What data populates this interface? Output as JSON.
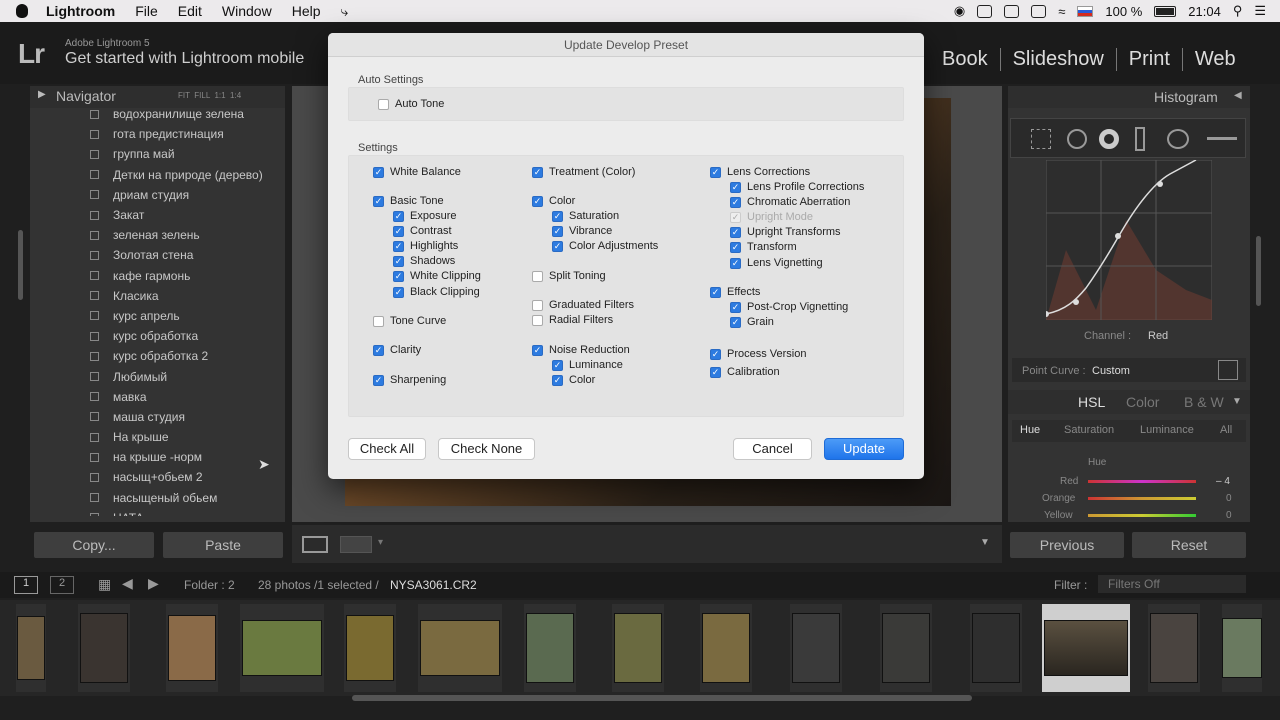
{
  "menubar": {
    "app": "Lightroom",
    "items": [
      "File",
      "Edit",
      "Window",
      "Help"
    ],
    "battery": "100 %",
    "time": "21:04"
  },
  "header": {
    "logo": "Lr",
    "version": "Adobe Lightroom 5",
    "mobile": "Get started with Lightroom mobile",
    "modules": [
      "Book",
      "Slideshow",
      "Print",
      "Web"
    ]
  },
  "left": {
    "navigator": "Navigator",
    "nav_opts": "FIT  FILL  1:1  1:4",
    "presets": [
      "водохранилище зелена",
      "гота предистинация",
      "группа май",
      "Детки на природе (дерево)",
      "дриам студия",
      "Закат",
      "зеленая зелень",
      "Золотая стена",
      "кафе гармонь",
      "Класика",
      "курс апрель",
      "курс обработка",
      "курс обработка 2",
      "Любимый",
      "мавка",
      "маша студия",
      "На крыше",
      "на крыше -норм",
      "насыщ+обьем 2",
      "насыщеный обьем",
      "НАТА..."
    ],
    "copy": "Copy...",
    "paste": "Paste"
  },
  "right": {
    "histogram": "Histogram",
    "channel_label": "Channel :",
    "channel_value": "Red",
    "point_curve_label": "Point Curve :",
    "point_curve_value": "Custom",
    "hsl_tabs": [
      "HSL",
      "Color",
      "B & W"
    ],
    "hsl_sub": [
      "Hue",
      "Saturation",
      "Luminance",
      "All"
    ],
    "hue_title": "Hue",
    "hue_rows": [
      {
        "name": "Red",
        "value": "– 4"
      },
      {
        "name": "Orange",
        "value": "0"
      },
      {
        "name": "Yellow",
        "value": "0"
      }
    ],
    "previous": "Previous",
    "reset": "Reset"
  },
  "filmstrip": {
    "pages": [
      "1",
      "2"
    ],
    "folder": "Folder : 2",
    "count": "28 photos /1 selected /",
    "file": "NYSA3061.CR2",
    "filter_label": "Filter :",
    "filter_value": "Filters Off"
  },
  "dialog": {
    "title": "Update Develop Preset",
    "auto_section": "Auto Settings",
    "auto_tone": "Auto Tone",
    "settings_section": "Settings",
    "col1": [
      {
        "label": "White Balance",
        "on": true,
        "indent": 0
      },
      {
        "label": "Basic Tone",
        "on": true,
        "indent": 0
      },
      {
        "label": "Exposure",
        "on": true,
        "indent": 1
      },
      {
        "label": "Contrast",
        "on": true,
        "indent": 1
      },
      {
        "label": "Highlights",
        "on": true,
        "indent": 1
      },
      {
        "label": "Shadows",
        "on": true,
        "indent": 1
      },
      {
        "label": "White Clipping",
        "on": true,
        "indent": 1
      },
      {
        "label": "Black Clipping",
        "on": true,
        "indent": 1
      },
      {
        "label": "Tone Curve",
        "on": false,
        "indent": 0
      },
      {
        "label": "Clarity",
        "on": true,
        "indent": 0
      },
      {
        "label": "Sharpening",
        "on": true,
        "indent": 0
      }
    ],
    "col2": [
      {
        "label": "Treatment (Color)",
        "on": true,
        "indent": 0
      },
      {
        "label": "Color",
        "on": true,
        "indent": 0
      },
      {
        "label": "Saturation",
        "on": true,
        "indent": 1
      },
      {
        "label": "Vibrance",
        "on": true,
        "indent": 1
      },
      {
        "label": "Color Adjustments",
        "on": true,
        "indent": 1
      },
      {
        "label": "Split Toning",
        "on": false,
        "indent": 0
      },
      {
        "label": "Graduated Filters",
        "on": false,
        "indent": 0
      },
      {
        "label": "Radial Filters",
        "on": false,
        "indent": 0
      },
      {
        "label": "Noise Reduction",
        "on": true,
        "indent": 0
      },
      {
        "label": "Luminance",
        "on": true,
        "indent": 1
      },
      {
        "label": "Color",
        "on": true,
        "indent": 1
      }
    ],
    "col3": [
      {
        "label": "Lens Corrections",
        "on": true,
        "indent": 0
      },
      {
        "label": "Lens Profile Corrections",
        "on": true,
        "indent": 1
      },
      {
        "label": "Chromatic Aberration",
        "on": true,
        "indent": 1
      },
      {
        "label": "Upright Mode",
        "on": true,
        "indent": 1,
        "disabled": true
      },
      {
        "label": "Upright Transforms",
        "on": true,
        "indent": 1
      },
      {
        "label": "Transform",
        "on": true,
        "indent": 1
      },
      {
        "label": "Lens Vignetting",
        "on": true,
        "indent": 1
      },
      {
        "label": "Effects",
        "on": true,
        "indent": 0
      },
      {
        "label": "Post-Crop Vignetting",
        "on": true,
        "indent": 1
      },
      {
        "label": "Grain",
        "on": true,
        "indent": 1
      },
      {
        "label": "Process Version",
        "on": true,
        "indent": 0
      },
      {
        "label": "Calibration",
        "on": true,
        "indent": 0
      }
    ],
    "buttons": {
      "check_all": "Check All",
      "check_none": "Check None",
      "cancel": "Cancel",
      "update": "Update"
    }
  },
  "colors": {
    "accent": "#2d7be0",
    "panel": "#333333",
    "dialog_bg": "#ececec"
  }
}
